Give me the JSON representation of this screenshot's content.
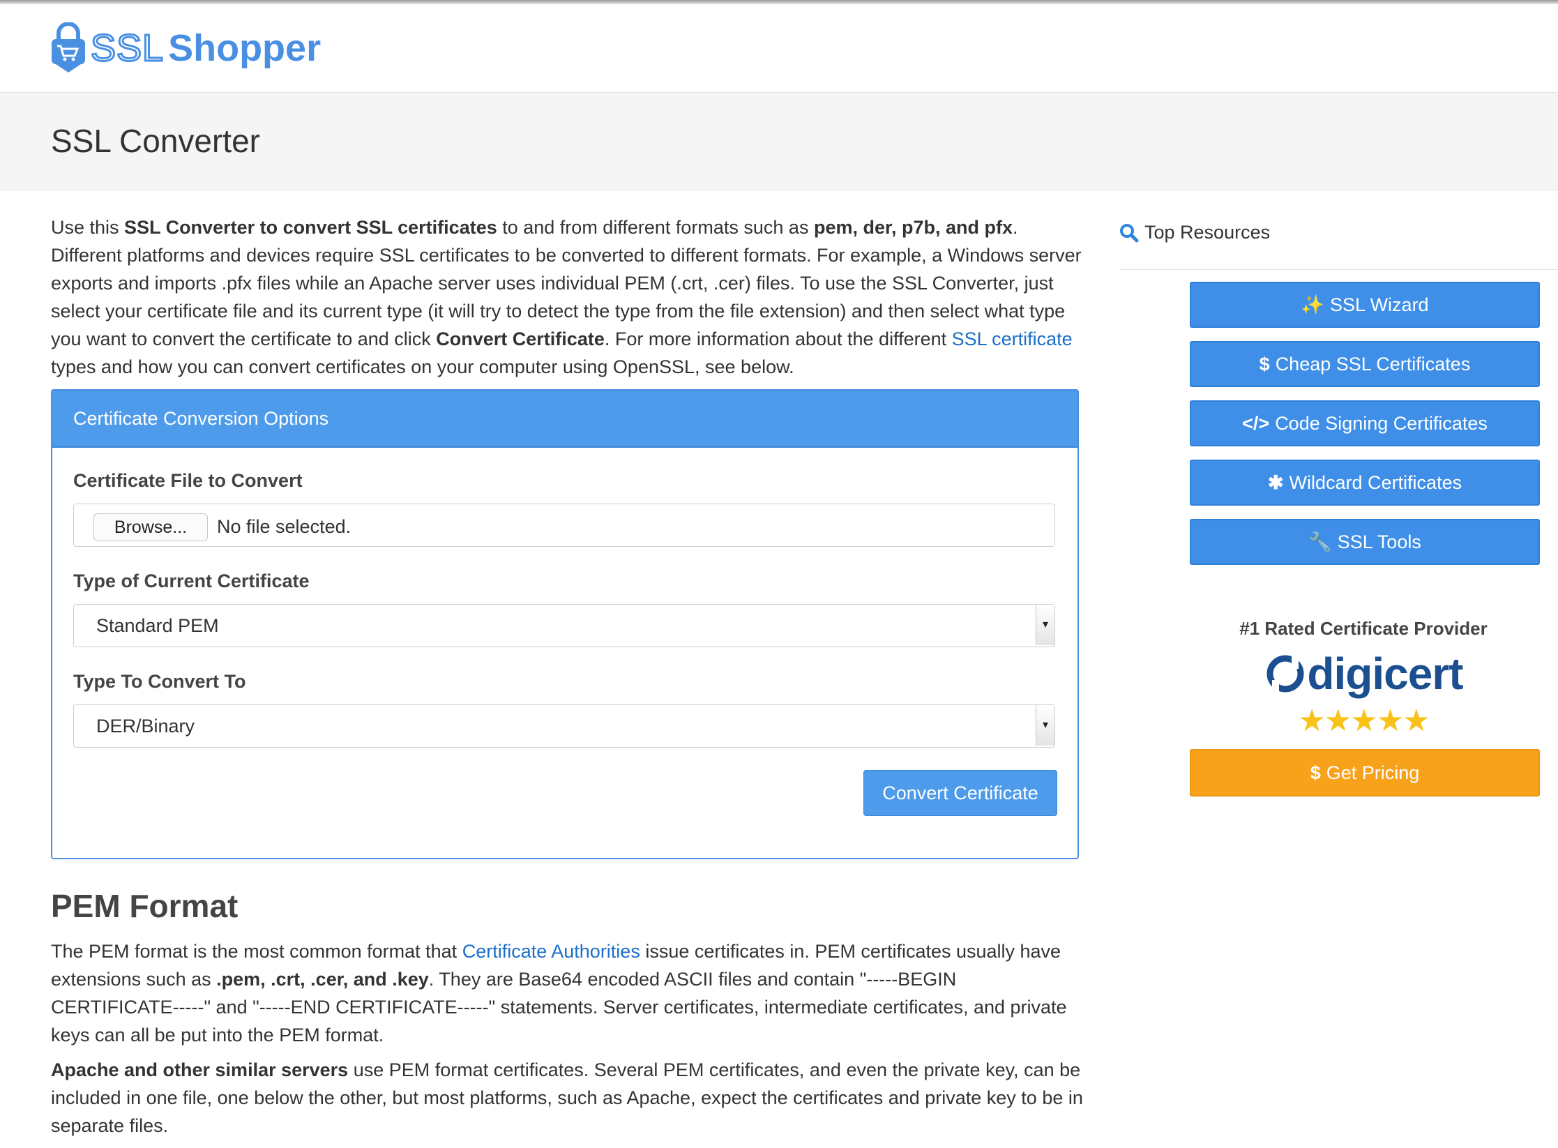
{
  "brand": {
    "ssl": "SSL",
    "shopper": "Shopper"
  },
  "page": {
    "title": "SSL Converter"
  },
  "intro": {
    "t1": "Use this ",
    "b1": "SSL Converter to convert SSL certificates",
    "t2": " to and from different formats such as ",
    "b2": "pem, der, p7b, and pfx",
    "t3": ". Different platforms and devices require SSL certificates to be converted to different formats. For example, a Windows server exports and imports .pfx files while an Apache server uses individual PEM (.crt, .cer) files. To use the SSL Converter, just select your certificate file and its current type (it will try to detect the type from the file extension) and then select what type you want to convert the certificate to and click ",
    "b3": "Convert Certificate",
    "t4": ". For more information about the different ",
    "link": "SSL certificate",
    "t5": " types and how you can convert certificates on your computer using OpenSSL, see below."
  },
  "panel": {
    "heading": "Certificate Conversion Options",
    "file_label": "Certificate File to Convert",
    "browse_label": "Browse...",
    "file_status": "No file selected.",
    "current_label": "Type of Current Certificate",
    "current_value": "Standard PEM",
    "convert_to_label": "Type To Convert To",
    "convert_to_value": "DER/Binary",
    "convert_button": "Convert Certificate"
  },
  "pem": {
    "heading": "PEM Format",
    "p1_t1": "The PEM format is the most common format that ",
    "p1_link": "Certificate Authorities",
    "p1_t2": " issue certificates in. PEM certificates usually have extensions such as ",
    "p1_b1": ".pem, .crt, .cer, and .key",
    "p1_t3": ". They are Base64 encoded ASCII files and contain \"-----BEGIN CERTIFICATE-----\" and \"-----END CERTIFICATE-----\" statements. Server certificates, intermediate certificates, and private keys can all be put into the PEM format.",
    "p2_b1": "Apache and other similar servers",
    "p2_t1": " use PEM format certificates. Several PEM certificates, and even the private key, can be included in one file, one below the other, but most platforms, such as Apache, expect the certificates and private key to be in separate files."
  },
  "sidebar": {
    "title": "Top Resources",
    "buttons": [
      {
        "icon": "magic-wand-icon",
        "glyph": "✨",
        "label": "SSL Wizard"
      },
      {
        "icon": "dollar-icon",
        "glyph": "$",
        "label": "Cheap SSL Certificates"
      },
      {
        "icon": "code-icon",
        "glyph": "</>",
        "label": "Code Signing Certificates"
      },
      {
        "icon": "asterisk-icon",
        "glyph": "✱",
        "label": "Wildcard Certificates"
      },
      {
        "icon": "wrench-icon",
        "glyph": "🔧",
        "label": "SSL Tools"
      }
    ],
    "rated": "#1 Rated Certificate Provider",
    "provider": "digicert",
    "stars": "★★★★★",
    "rating": 5,
    "pricing_glyph": "$",
    "pricing_label": "Get Pricing"
  },
  "colors": {
    "brand_blue": "#4a90e2",
    "button_blue": "#3f8fe8",
    "orange": "#f8a21b",
    "link": "#1a6fc9"
  }
}
